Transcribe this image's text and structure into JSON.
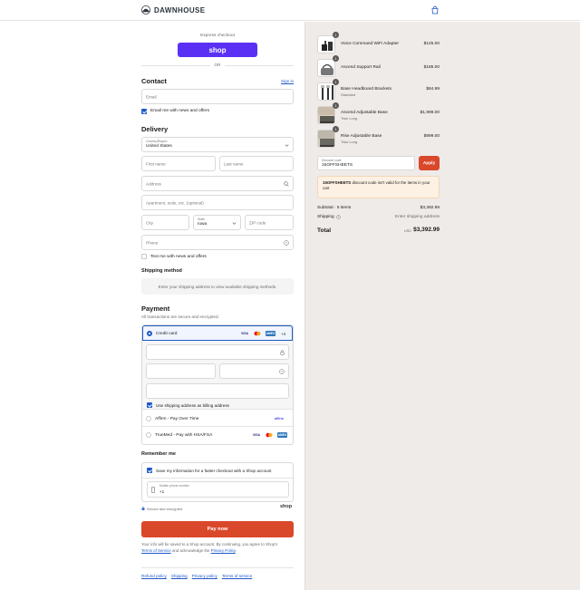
{
  "brand": {
    "name": "DAWNHOUSE"
  },
  "express": {
    "label": "Express checkout",
    "shop_label": "shop",
    "or": "OR"
  },
  "contact": {
    "title": "Contact",
    "sign_in": "Sign in",
    "email_placeholder": "Email",
    "news_label": "Email me with news and offers"
  },
  "delivery": {
    "title": "Delivery",
    "country_label": "Country/Region",
    "country_value": "United States",
    "first_name": "First name",
    "last_name": "Last name",
    "address": "Address",
    "apartment": "Apartment, suite, etc. (optional)",
    "city": "City",
    "state_label": "State",
    "state_value": "Iowa",
    "zip": "ZIP code",
    "phone": "Phone",
    "sms_label": "Text me with news and offers"
  },
  "shipping_method": {
    "title": "Shipping method",
    "message": "Enter your shipping address to view available shipping methods."
  },
  "payment": {
    "title": "Payment",
    "subtitle": "All transactions are secure and encrypted.",
    "credit_card": "Credit card",
    "more_cards": "+4",
    "billing_label": "Use shipping address as billing address",
    "affirm": "Affirm - Pay Over Time",
    "affirm_logo": "affirm",
    "truemed": "TrueMed - Pay with HSA/FSA",
    "visa": "VISA",
    "amex": "AMEX"
  },
  "remember": {
    "title": "Remember me",
    "save_label": "Save my information for a faster checkout with a Shop account",
    "mobile_label": "Mobile phone number",
    "mobile_value": "+1",
    "secure": "Secure and encrypted",
    "shop": "shop"
  },
  "pay_now": "Pay now",
  "legal": {
    "line1": "Your info will be saved to a Shop account. By continuing, you agree to Shop's",
    "terms": "Terms of Service",
    "and": "and acknowledge the",
    "privacy": "Privacy Policy",
    "period": "."
  },
  "footer_links": [
    "Refund policy",
    "Shipping",
    "Privacy policy",
    "Terms of service"
  ],
  "order": {
    "items": [
      {
        "name": "Voice Command WiFi Adapter",
        "variant": "",
        "price": "$125.00",
        "qty": "1"
      },
      {
        "name": "Ascend Support Rail",
        "variant": "",
        "price": "$185.00",
        "qty": "1"
      },
      {
        "name": "Base Headboard Brackets",
        "variant": "Standard",
        "price": "$84.99",
        "qty": "1"
      },
      {
        "name": "Ascend Adjustable Base",
        "variant": "Twin Long",
        "price": "$1,999.00",
        "qty": "1"
      },
      {
        "name": "Rise Adjustable Base",
        "variant": "Twin Long",
        "price": "$999.00",
        "qty": "1"
      }
    ],
    "discount_label": "Discount code",
    "discount_value": "15OFFSHEETS",
    "apply": "Apply",
    "error_code": "15OFFSHEETS",
    "error_text": "discount code isn't valid for the items in your cart",
    "subtotal_label": "Subtotal · 5 items",
    "subtotal_value": "$3,392.99",
    "shipping_label": "Shipping",
    "shipping_value": "Enter shipping address",
    "total_label": "Total",
    "currency": "USD",
    "total_value": "$3,392.99"
  },
  "colors": {
    "shop_purple": "#5a31f4",
    "pay_red": "#d9482b",
    "link_blue": "#1f59c8"
  }
}
